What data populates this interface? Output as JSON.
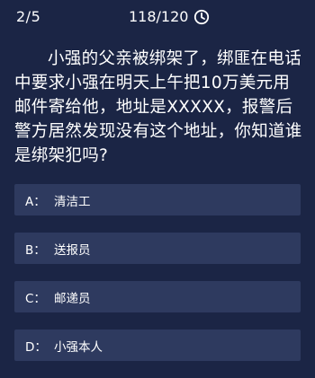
{
  "header": {
    "progress": "2/5",
    "timer": "118/120",
    "timer_icon": "clock-icon"
  },
  "question": {
    "text": "小强的父亲被绑架了，绑匪在电话中要求小强在明天上午把10万美元用邮件寄给他，地址是XXXXX，报警后警方居然发现没有这个地址，你知道谁是绑架犯吗?"
  },
  "options": [
    {
      "letter": "A：",
      "text": "清洁工"
    },
    {
      "letter": "B：",
      "text": "送报员"
    },
    {
      "letter": "C：",
      "text": "邮递员"
    },
    {
      "letter": "D：",
      "text": "小强本人"
    }
  ],
  "colors": {
    "background": "#1b2545",
    "option_background": "#2e3a5f",
    "text": "#ffffff"
  }
}
